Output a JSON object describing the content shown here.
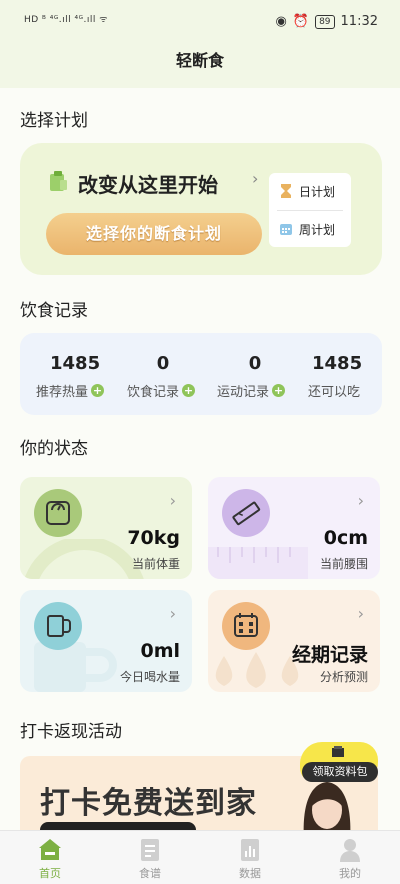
{
  "status_bar": {
    "left_indicators": "HD ᴮ ⁴ᴳ.ıll ⁴ᴳ.ıll ᯤ",
    "battery": "89",
    "time": "11:32"
  },
  "header": {
    "title": "轻断食"
  },
  "plan": {
    "section_title": "选择计划",
    "heading": "改变从这里开始",
    "button_label": "选择你的断食计划",
    "options": [
      {
        "label": "日计划",
        "icon": "hourglass-icon"
      },
      {
        "label": "周计划",
        "icon": "calendar-icon"
      }
    ]
  },
  "diet": {
    "section_title": "饮食记录",
    "stats": [
      {
        "value": "1485",
        "label": "推荐热量",
        "has_plus": true
      },
      {
        "value": "0",
        "label": "饮食记录",
        "has_plus": true
      },
      {
        "value": "0",
        "label": "运动记录",
        "has_plus": true
      },
      {
        "value": "1485",
        "label": "还可以吃",
        "has_plus": false
      }
    ]
  },
  "status": {
    "section_title": "你的状态",
    "cards": [
      {
        "value": "70kg",
        "label": "当前体重",
        "icon": "scale-icon",
        "color": "#a9c97a",
        "bg": "#eef5de"
      },
      {
        "value": "0cm",
        "label": "当前腰围",
        "icon": "ruler-icon",
        "color": "#cdb6e8",
        "bg": "#f5f0fb"
      },
      {
        "value": "0ml",
        "label": "今日喝水量",
        "icon": "cup-icon",
        "color": "#8fd0d8",
        "bg": "#eaf4f6"
      },
      {
        "value": "经期记录",
        "label": "分析预测",
        "icon": "calendar-grid-icon",
        "color": "#f0b77e",
        "bg": "#fbf0e4"
      }
    ]
  },
  "promo": {
    "section_title": "打卡返现活动",
    "headline": "打卡免费送到家",
    "badge": "领取资料包"
  },
  "tabs": [
    {
      "label": "首页",
      "icon": "home-icon",
      "active": true
    },
    {
      "label": "食谱",
      "icon": "recipe-icon",
      "active": false
    },
    {
      "label": "数据",
      "icon": "data-icon",
      "active": false
    },
    {
      "label": "我的",
      "icon": "profile-icon",
      "active": false
    }
  ],
  "colors": {
    "accent": "#7db043",
    "header_bg": "#f2f7e6",
    "plan_button": "#eab46c"
  }
}
